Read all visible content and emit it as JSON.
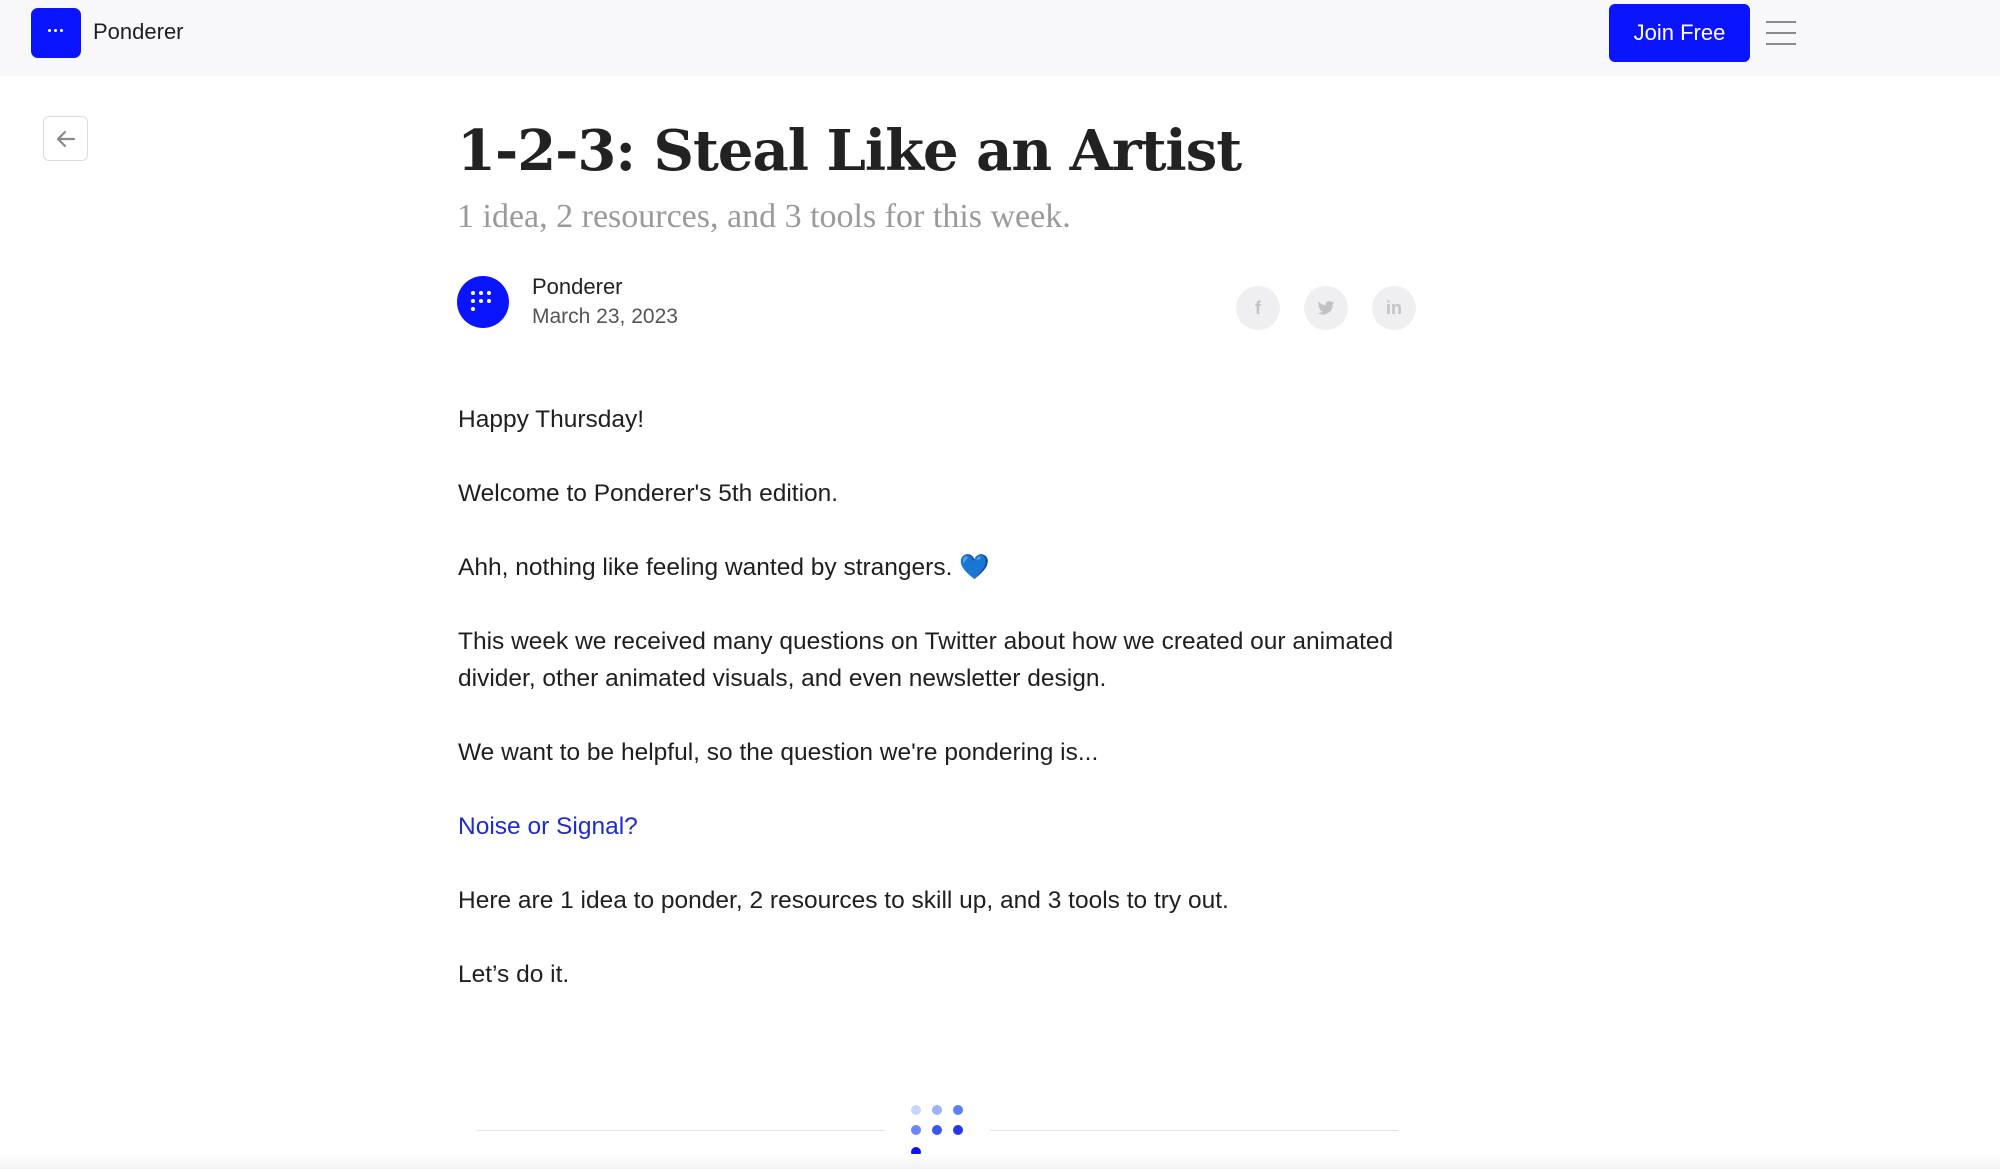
{
  "header": {
    "brand_name": "Ponderer",
    "join_label": "Join Free",
    "logo_icon": "dots-logo-icon",
    "menu_icon": "hamburger-menu-icon",
    "accent_color": "#0a14ff"
  },
  "nav": {
    "back_icon": "arrow-left-icon"
  },
  "article": {
    "title": "1-2-3: Steal Like an Artist",
    "subtitle": "1 idea, 2 resources, and 3 tools for this week.",
    "author": {
      "name": "Ponderer",
      "date": "March 23, 2023"
    },
    "share": [
      {
        "icon": "facebook-icon",
        "glyph": "f"
      },
      {
        "icon": "twitter-icon",
        "glyph": "t"
      },
      {
        "icon": "linkedin-icon",
        "glyph": "in"
      }
    ],
    "paragraphs": [
      "Happy Thursday!",
      "Welcome to Ponderer's 5th edition.",
      "Ahh, nothing like feeling wanted by strangers. 💙",
      "This week we received many questions on Twitter about how we created our animated divider, other animated visuals, and even newsletter design.",
      "We want to be helpful, so the question we're pondering is...",
      "Noise or Signal?",
      "Here are 1 idea to ponder, 2 resources to skill up, and 3 tools to try out.",
      "Let’s do it."
    ],
    "link_color": "#1d2dcb"
  },
  "divider": {
    "icon": "animated-dots-divider-icon"
  }
}
